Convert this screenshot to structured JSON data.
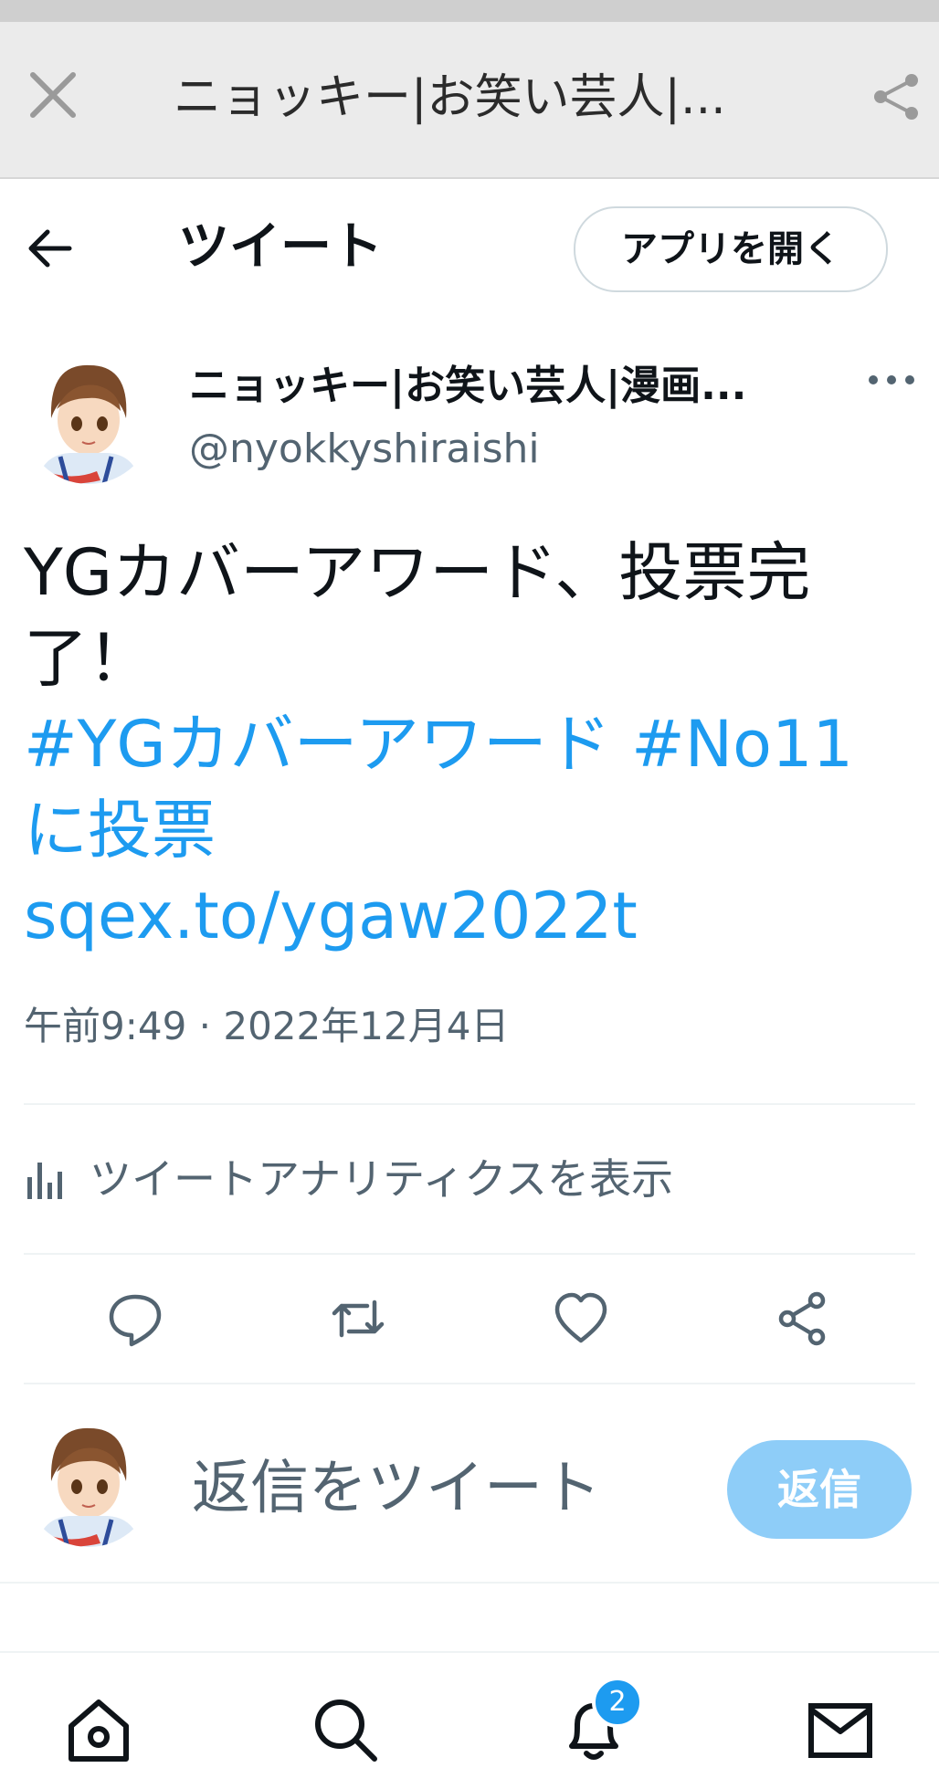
{
  "browser": {
    "title": "ニョッキー|お笑い芸人|...",
    "close_icon": "close-icon",
    "share_icon": "share-icon"
  },
  "header": {
    "back_icon": "arrow-left-icon",
    "title": "ツイート",
    "open_app_label": "アプリを開く"
  },
  "tweet": {
    "author_name": "ニョッキー|お笑い芸人|漫画...",
    "author_handle": "@nyokkyshiraishi",
    "text_main": "YGカバーアワード、投票完了！",
    "hashtag1": "#YGカバーアワード",
    "hashtag2": "#No11",
    "text_tail": "に投票",
    "link": "sqex.to/ygaw2022t",
    "timestamp": "午前9:49 · 2022年12月4日",
    "analytics_label": "ツイートアナリティクスを表示"
  },
  "actions": [
    "reply-icon",
    "retweet-icon",
    "like-icon",
    "share-icon"
  ],
  "reply_bar": {
    "placeholder": "返信をツイート",
    "button_label": "返信"
  },
  "bottom_nav": {
    "items": [
      "home-icon",
      "search-icon",
      "notifications-icon",
      "messages-icon"
    ],
    "notification_count": "2"
  },
  "colors": {
    "accent": "#1d9bf0",
    "reply_button_disabled": "#8ecdf8",
    "secondary_text": "#536471"
  }
}
